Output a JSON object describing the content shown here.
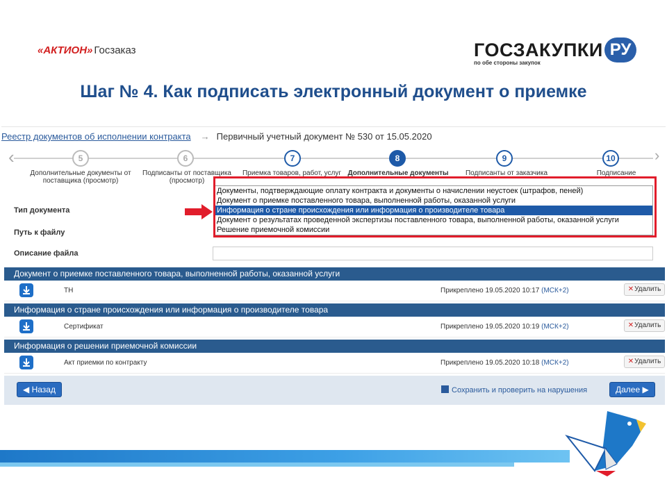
{
  "slide": {
    "logo_left_brand": "«АКТИОН»",
    "logo_left_sub": "Госзаказ",
    "logo_right_word": "ГОСЗАКУПКИ",
    "logo_right_ru": "РУ",
    "logo_right_tagline": "по обе стороны закупок",
    "title": "Шаг № 4. Как подписать электронный документ о приемке"
  },
  "breadcrumb": {
    "link": "Реестр документов об исполнении контракта",
    "current": "Первичный учетный документ № 530 от 15.05.2020"
  },
  "steps": [
    {
      "num": "5",
      "label": "Дополнительные документы от поставщика (просмотр)"
    },
    {
      "num": "6",
      "label": "Подписанты от поставщика (просмотр)"
    },
    {
      "num": "7",
      "label": "Приемка товаров, работ, услуг"
    },
    {
      "num": "8",
      "label": "Дополнительные документы"
    },
    {
      "num": "9",
      "label": "Подписанты от заказчика"
    },
    {
      "num": "10",
      "label": "Подписание"
    }
  ],
  "form": {
    "doc_type_label": "Тип документа",
    "file_path_label": "Путь к файлу",
    "file_desc_label": "Описание файла",
    "doc_type_options": [
      "Документы, подтверждающие оплату контракта и документы о начислении неустоек (штрафов, пеней)",
      "Документ о приемке поставленного товара, выполненной работы, оказанной услуги",
      "Информация о стране происхождения или информация о производителе товара",
      "Документ о результатах проведенной экспертизы поставленного товара, выполненной работы, оказанной услуги",
      "Решение приемочной комиссии"
    ],
    "selected_index": 2
  },
  "sections": [
    {
      "title": "Документ о приемке поставленного товара, выполненной работы, оказанной услуги",
      "file": "ТН",
      "attached": "Прикреплено 19.05.2020 10:17",
      "tz": "(МСК+2)",
      "delete": "Удалить"
    },
    {
      "title": "Информация о стране происхождения или информация о производителе товара",
      "file": "Сертификат",
      "attached": "Прикреплено 19.05.2020 10:19",
      "tz": "(МСК+2)",
      "delete": "Удалить"
    },
    {
      "title": "Информация о решении приемочной комиссии",
      "file": "Акт приемки по контракту",
      "attached": "Прикреплено 19.05.2020 10:18",
      "tz": "(МСК+2)",
      "delete": "Удалить"
    }
  ],
  "footer": {
    "back": "Назад",
    "save": "Сохранить и проверить на нарушения",
    "next": "Далее"
  },
  "colors": {
    "accent": "#1e5aa8",
    "section_header": "#2a5b8e",
    "highlight": "#e11d2b"
  }
}
